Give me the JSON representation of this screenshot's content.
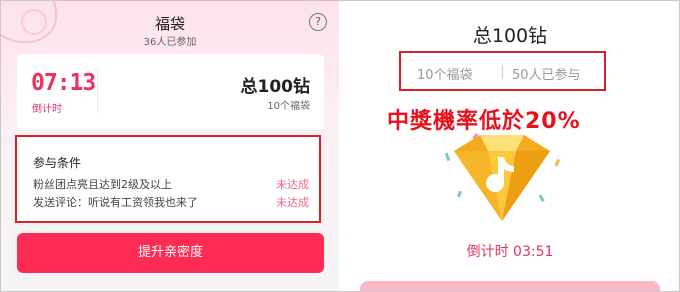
{
  "left_panel": {
    "title": "福袋",
    "participants": "36人已参加",
    "help_icon": "question-circle",
    "timer": {
      "value": "07:13",
      "label": "倒计时"
    },
    "total": {
      "value": "总100钻",
      "count": "10个福袋"
    },
    "conditions": {
      "title": "参与条件",
      "items": [
        {
          "text": "粉丝团点亮且达到2级及以上",
          "status": "未达成"
        },
        {
          "text": "发送评论：听说有工资领我也来了",
          "status": "未达成"
        }
      ]
    },
    "primary_button": "提升亲密度"
  },
  "right_panel": {
    "title": "总100钻",
    "bags": "10个福袋",
    "participants": "50人已参与",
    "overlay_text": "中獎機率低於20%",
    "gem_icon": "tiktok-diamond",
    "countdown": "倒计时 03:51"
  },
  "colors": {
    "brand": "#fe2c55",
    "timer": "#e63560",
    "status": "#f06a85",
    "highlight_border": "#d6222b",
    "overlay": "#e8121d"
  }
}
